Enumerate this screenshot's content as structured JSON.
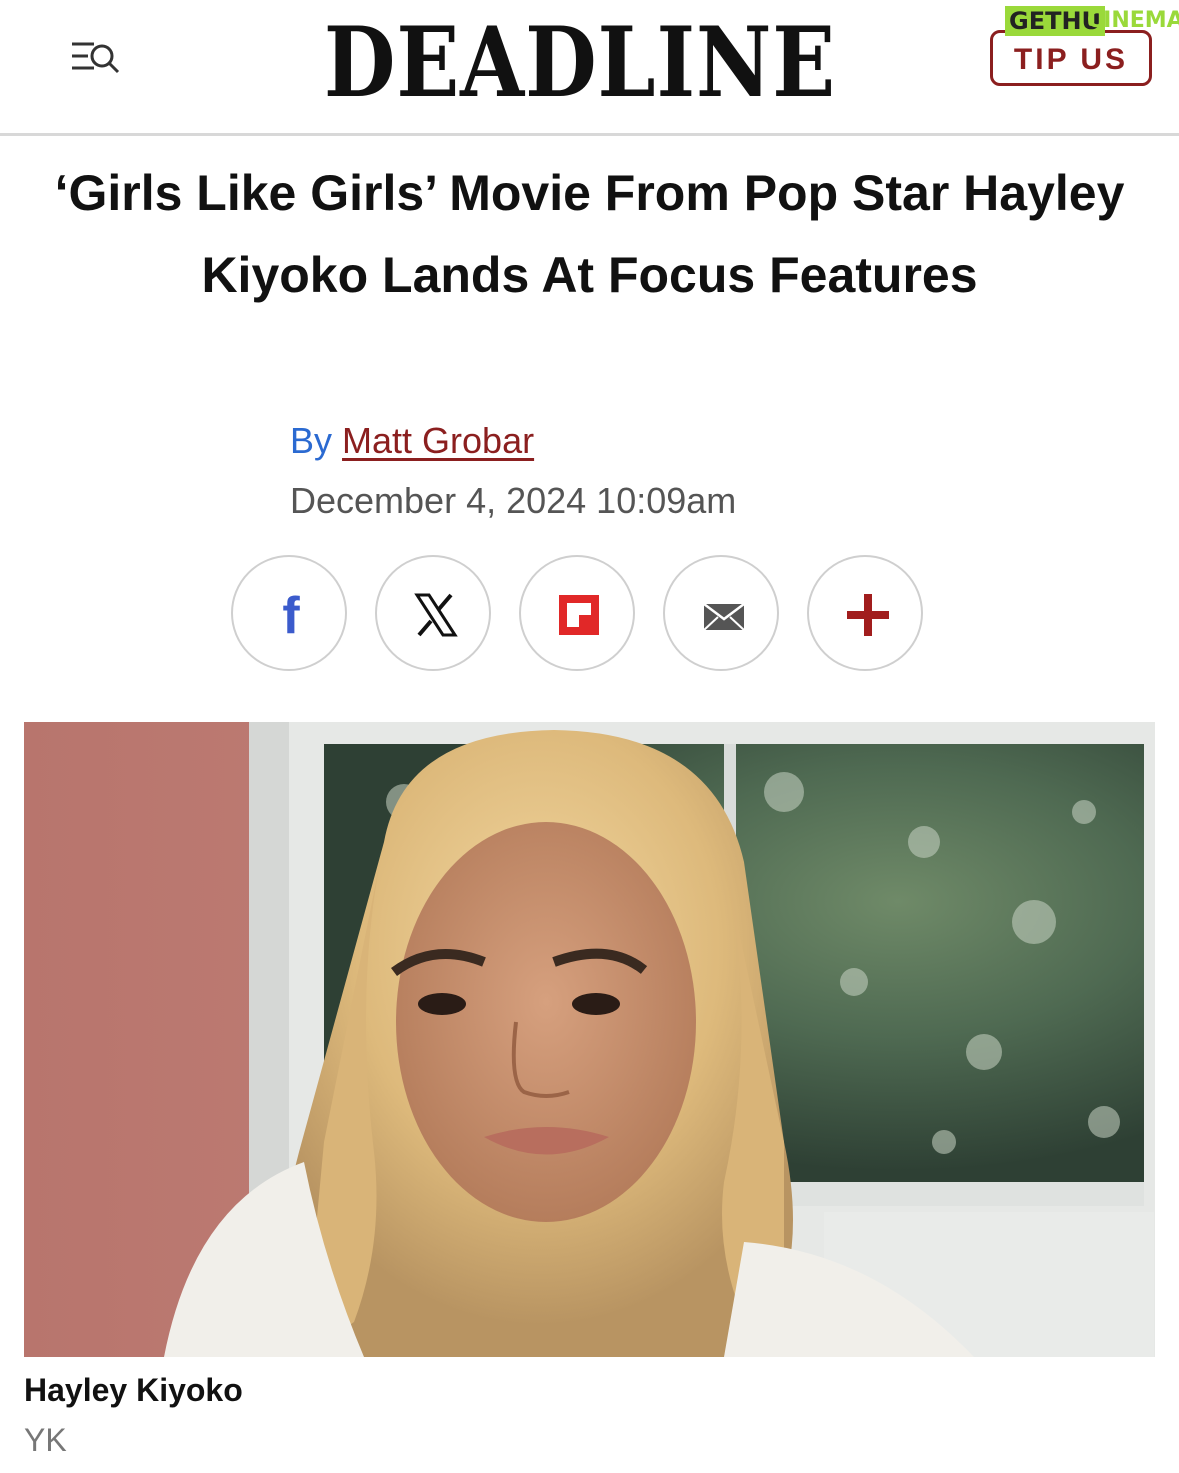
{
  "header": {
    "logo": "DEADLINE",
    "tip_button": "TIP US",
    "menu_icon": "menu-search-icon",
    "watermark_part1": "GETHU",
    "watermark_part2": "CINEMA"
  },
  "article": {
    "headline": "‘Girls Like Girls’ Movie From Pop Star Hayley Kiyoko Lands At Focus Features",
    "by_label": "By",
    "author": "Matt Grobar",
    "date": "December 4, 2024 10:09am"
  },
  "share": [
    {
      "icon": "facebook-icon",
      "color": "#3b5bcc"
    },
    {
      "icon": "x-icon",
      "color": "#111111"
    },
    {
      "icon": "flipboard-icon",
      "color": "#e12828"
    },
    {
      "icon": "email-icon",
      "color": "#555555"
    },
    {
      "icon": "plus-icon",
      "color": "#a11d1d"
    }
  ],
  "image": {
    "caption": "Hayley Kiyoko",
    "credit": "YK"
  },
  "colors": {
    "accent": "#8b1f1f",
    "link_blue": "#2b6ad1"
  }
}
